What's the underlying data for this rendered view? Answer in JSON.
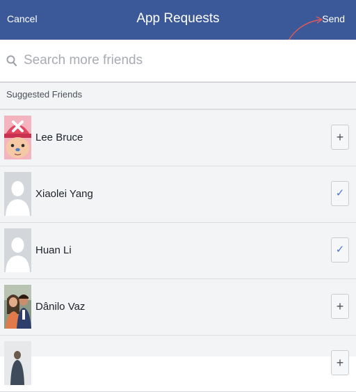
{
  "navbar": {
    "cancel_label": "Cancel",
    "title": "App Requests",
    "send_label": "Send",
    "background": "#3b5998"
  },
  "search": {
    "placeholder": "Search more friends",
    "value": ""
  },
  "section": {
    "title": "Suggested Friends"
  },
  "friends": [
    {
      "name": "Lee Bruce",
      "avatar": "cartoon-avatar",
      "action": "add",
      "action_glyph": "+"
    },
    {
      "name": "Xiaolei Yang",
      "avatar": "default-silhouette-avatar",
      "action": "selected",
      "action_glyph": "✓"
    },
    {
      "name": "Huan Li",
      "avatar": "default-silhouette-avatar",
      "action": "selected",
      "action_glyph": "✓"
    },
    {
      "name": "Dânilo Vaz",
      "avatar": "photo-avatar",
      "action": "add",
      "action_glyph": "+"
    },
    {
      "name": "",
      "avatar": "photo-avatar",
      "action": "add",
      "action_glyph": "+"
    }
  ],
  "colors": {
    "accent": "#3b5998",
    "check": "#4a76c9",
    "annotation": "#e05a5a"
  }
}
